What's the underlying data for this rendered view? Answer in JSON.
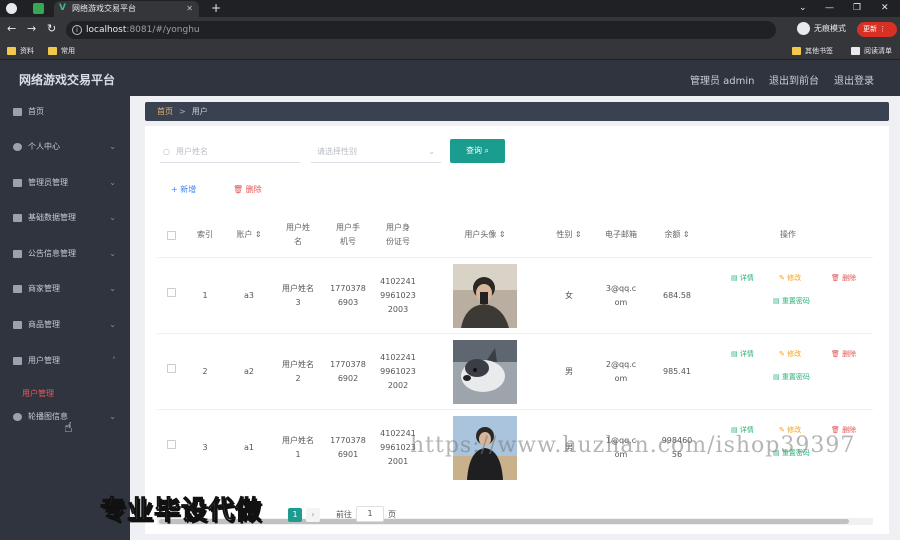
{
  "browser": {
    "tab_title": "网络游戏交易平台",
    "url_host": "localhost",
    "url_path": ":8081/#/yonghu",
    "incognito_label": "无痕模式",
    "update_label": "更新",
    "bookmarks": [
      "资料",
      "常用"
    ],
    "bookmarks_right": [
      "其他书签",
      "阅读清单"
    ]
  },
  "header": {
    "app_title": "网络游戏交易平台",
    "admin_label": "管理员 admin",
    "exit_to_front": "退出到前台",
    "logout": "退出登录"
  },
  "sidebar": {
    "items": [
      {
        "label": "首页",
        "icon": "home-icon",
        "has_arrow": false
      },
      {
        "label": "个人中心",
        "icon": "user-icon",
        "has_arrow": true
      },
      {
        "label": "管理员管理",
        "icon": "admin-icon",
        "has_arrow": true
      },
      {
        "label": "基础数据管理",
        "icon": "data-icon",
        "has_arrow": true
      },
      {
        "label": "公告信息管理",
        "icon": "flag-icon",
        "has_arrow": true
      },
      {
        "label": "商家管理",
        "icon": "shop-icon",
        "has_arrow": true
      },
      {
        "label": "商品管理",
        "icon": "goods-icon",
        "has_arrow": true
      },
      {
        "label": "用户管理",
        "icon": "users-icon",
        "has_arrow": true
      },
      {
        "label": "轮播图信息",
        "icon": "carousel-icon",
        "has_arrow": true
      }
    ],
    "submenu_active": "用户管理"
  },
  "breadcrumb": {
    "home": "首页",
    "sep": ">",
    "current": "用户"
  },
  "search": {
    "name_placeholder": "用户姓名",
    "gender_placeholder": "请选择性别",
    "query_label": "查询"
  },
  "actions": {
    "add_label": "新增",
    "delete_label": "删除"
  },
  "table": {
    "headers": [
      "索引",
      "账户",
      "用户姓名",
      "用户手机号",
      "用户身份证号",
      "用户头像",
      "性别",
      "电子邮箱",
      "余额",
      "操作"
    ],
    "rows": [
      {
        "index": "1",
        "account": "a3",
        "name": "用户姓名3",
        "phone": "17703786903",
        "idcard": "410224199610232003",
        "gender": "女",
        "email": "3@qq.com",
        "balance": "684.58"
      },
      {
        "index": "2",
        "account": "a2",
        "name": "用户姓名2",
        "phone": "17703786902",
        "idcard": "410224199610232002",
        "gender": "男",
        "email": "2@qq.com",
        "balance": "985.41"
      },
      {
        "index": "3",
        "account": "a1",
        "name": "用户姓名1",
        "phone": "17703786901",
        "idcard": "410224199610232001",
        "gender": "男",
        "email": "1@qq.com",
        "balance": "99846056"
      }
    ],
    "ops": {
      "detail": "详情",
      "edit": "修改",
      "delete": "删除",
      "reset": "重置密码"
    }
  },
  "pager": {
    "page": "1",
    "goto_label": "前往",
    "goto_value": "1",
    "unit_label": "页"
  },
  "watermark": {
    "main": "专业毕设代做",
    "url": "https://www.huzhan.com/ishop39397"
  }
}
